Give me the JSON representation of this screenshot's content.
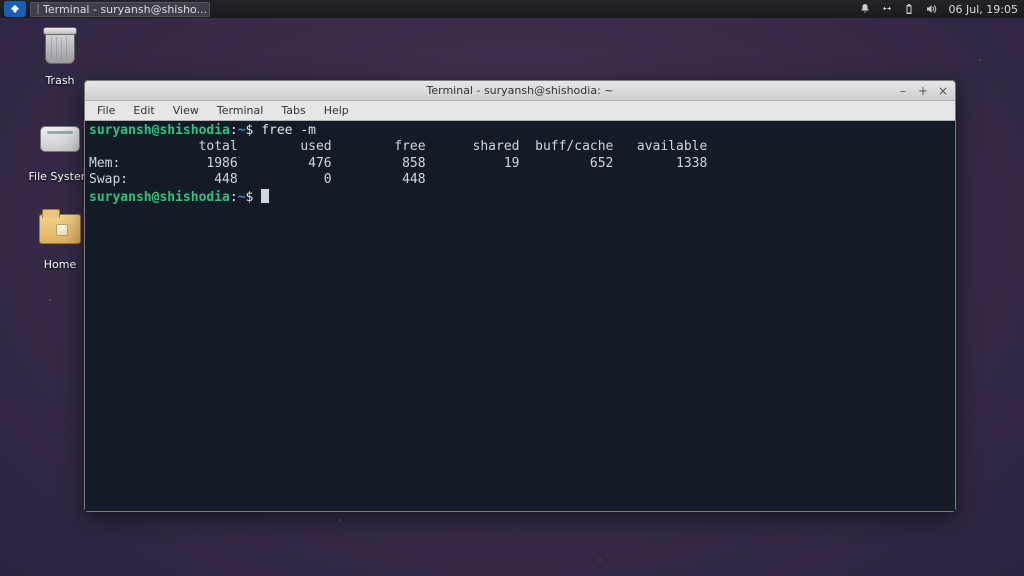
{
  "panel": {
    "task_label": "Terminal - suryansh@shisho...",
    "clock": "06 Jul, 19:05"
  },
  "desktop": {
    "trash": "Trash",
    "filesystem": "File System",
    "home": "Home"
  },
  "window": {
    "title": "Terminal - suryansh@shishodia: ~",
    "menu": {
      "file": "File",
      "edit": "Edit",
      "view": "View",
      "terminal": "Terminal",
      "tabs": "Tabs",
      "help": "Help"
    }
  },
  "terminal": {
    "prompt_user": "suryansh@shishodia",
    "prompt_sep": ":",
    "prompt_path": "~",
    "prompt_end": "$ ",
    "command": "free -m",
    "header": "              total        used        free      shared  buff/cache   available",
    "rows": {
      "mem": "Mem:           1986         476         858          19         652        1338",
      "swap": "Swap:           448           0         448"
    }
  }
}
